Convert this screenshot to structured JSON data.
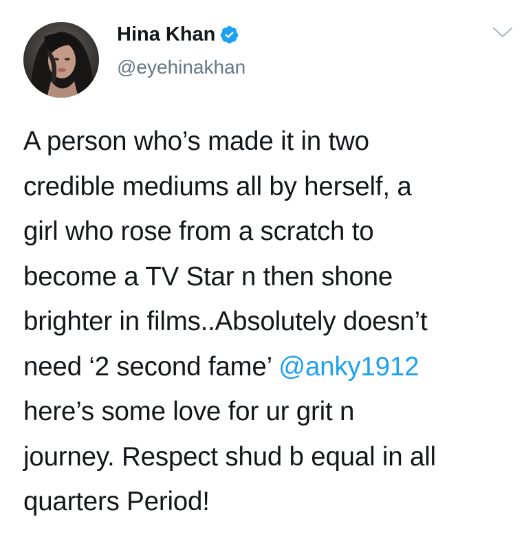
{
  "author": {
    "display_name": "Hina Khan",
    "handle": "@eyehinakhan",
    "verified_icon": "verified-badge-icon",
    "verified_color": "#1da1f2"
  },
  "menu": {
    "icon": "chevron-down-icon"
  },
  "tweet": {
    "lines": [
      "A person who’s made it in two",
      "credible mediums all by herself, a",
      "girl who rose from a scratch to",
      "become a TV Star n then shone",
      "brighter in films..Absolutely doesn’t"
    ],
    "line6_prefix": "need ‘2 second fame’ ",
    "mention": "@anky1912",
    "lines_after": [
      "here’s some love for ur grit n",
      "journey. Respect shud b equal in all",
      "quarters Period!"
    ]
  },
  "colors": {
    "text": "#14171a",
    "secondary": "#657786",
    "link": "#1da1f2"
  }
}
